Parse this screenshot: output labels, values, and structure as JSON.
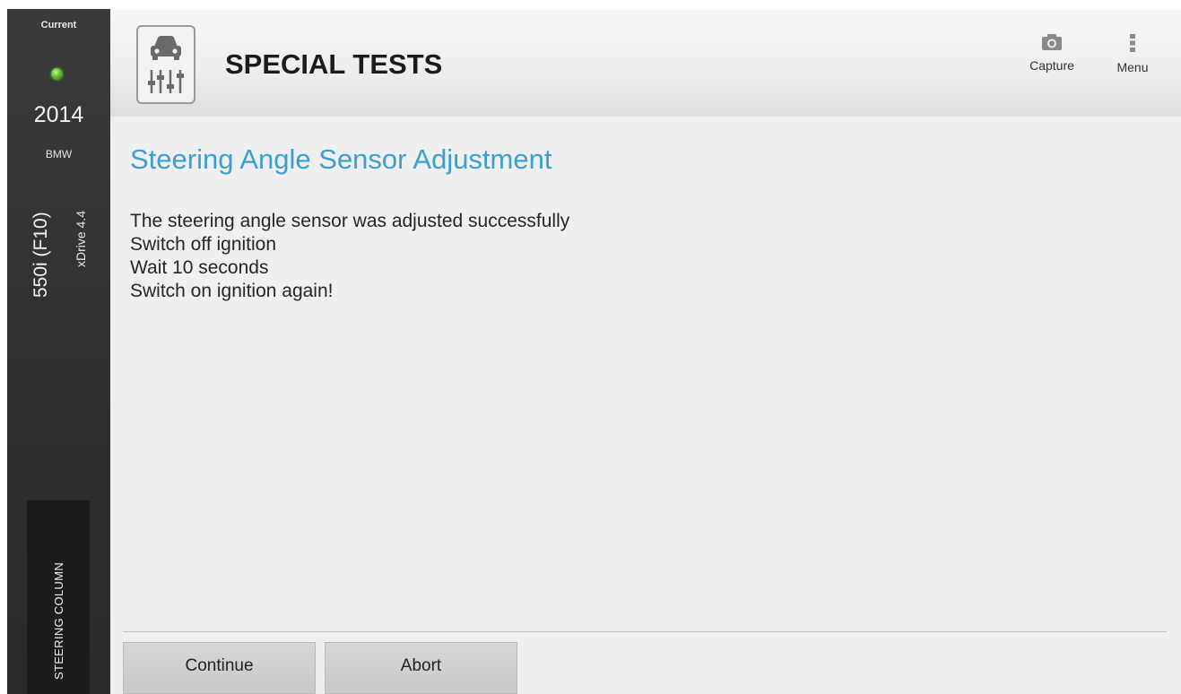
{
  "sidebar": {
    "current_label": "Current",
    "year": "2014",
    "make": "BMW",
    "model": "550i (F10)",
    "drive": "xDrive 4.4",
    "system": "STEERING COLUMN",
    "status_color": "#5fbf2b"
  },
  "header": {
    "title": "SPECIAL TESTS",
    "app_icon": "car-adjust-icon",
    "capture_label": "Capture",
    "capture_icon": "camera-icon",
    "menu_label": "Menu",
    "menu_icon": "vertical-dots-icon"
  },
  "content": {
    "title": "Steering Angle Sensor Adjustment",
    "title_color": "#3b9fcf",
    "messages": [
      "The steering angle sensor was adjusted successfully",
      "Switch off ignition",
      "Wait 10 seconds",
      "Switch on ignition again!"
    ]
  },
  "actions": {
    "continue_label": "Continue",
    "abort_label": "Abort"
  }
}
